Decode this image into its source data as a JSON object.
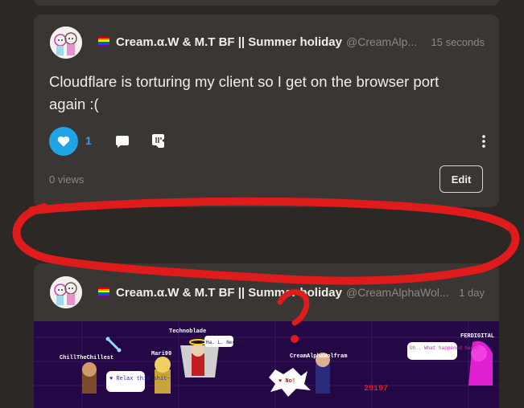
{
  "post_1": {
    "display_name": "Cream.α.W & M.T BF || Summer holiday",
    "handle": "@CreamAlp...",
    "timestamp": "15 seconds",
    "content": "Cloudflare is torturing my client so I get on the browser port again :(",
    "like_count": "1",
    "views": "0 views",
    "edit_label": "Edit"
  },
  "post_2": {
    "display_name": "Cream.α.W & M.T BF || Summer holiday",
    "handle": "@CreamAlphaWol...",
    "timestamp": "1 day",
    "image_labels": {
      "chill": "ChillTheChillest",
      "techno": "Technoblade",
      "techno_bubble": "Ha. L. Nerds!",
      "mari": "Mari99",
      "cream": "CreamAlphaWolfram",
      "no_bubble": "♥ No!",
      "ferd": "FERDIGITAL",
      "ferd_bubble": "Uh.. What happened here?",
      "blue_bubble": "♥ Relax this shit-",
      "score": "29197"
    }
  },
  "colors": {
    "background": "#2b2826",
    "card": "#3a3633",
    "accent": "#1fa5e7",
    "scribble": "#e01b1b"
  },
  "icons": {
    "like": "heart-icon",
    "reply": "speech-bubble-icon",
    "reblog": "reblog-icon",
    "more": "kebab-menu-icon",
    "flag": "pride-flag-icon"
  }
}
